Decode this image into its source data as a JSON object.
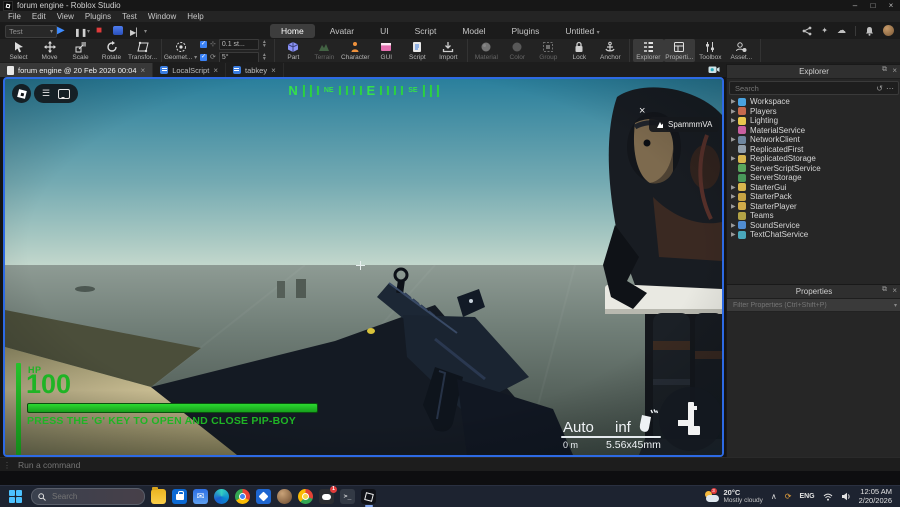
{
  "window": {
    "title": "forum engine - Roblox Studio"
  },
  "menu": {
    "items": [
      "File",
      "Edit",
      "View",
      "Plugins",
      "Test",
      "Window",
      "Help"
    ]
  },
  "playbar": {
    "test_mode": "Test"
  },
  "tabs": {
    "items": [
      "Home",
      "Avatar",
      "UI",
      "Script",
      "Model",
      "Plugins",
      "Untitled"
    ],
    "active": "Home"
  },
  "ribbon": {
    "select": "Select",
    "move": "Move",
    "scale": "Scale",
    "rotate": "Rotate",
    "transform": "Transfor...",
    "geometric": "Geomet...",
    "snap_move": "0.1 st...",
    "snap_rotate": "5°",
    "part": "Part",
    "terrain": "Terrain",
    "character": "Character",
    "gui": "GUI",
    "script": "Script",
    "import": "Import",
    "material": "Material",
    "color": "Color",
    "group": "Group",
    "lock": "Lock",
    "anchor": "Anchor",
    "explorer": "Explorer",
    "properties": "Properti...",
    "toolbox": "Toolbox",
    "asset": "Asset..."
  },
  "doc_tabs": {
    "items": [
      "forum engine @ 20 Feb 2026 00:04",
      "LocalScript",
      "tabkey"
    ]
  },
  "game": {
    "compass": {
      "n": "N",
      "ne": "NE",
      "e": "E",
      "se": "SE"
    },
    "nametag": "SpammmVA",
    "hp_label": "HP",
    "hp_value": "100",
    "pipboy_hint": "PRESS THE 'G' KEY TO OPEN AND CLOSE PIP-BOY",
    "fire_mode": "Auto",
    "ammo_count": "inf",
    "distance": "0 m",
    "caliber": "5.56x45mm"
  },
  "explorer": {
    "title": "Explorer",
    "search_placeholder": "Search",
    "items": [
      {
        "label": "Workspace",
        "expandable": true
      },
      {
        "label": "Players",
        "expandable": true
      },
      {
        "label": "Lighting",
        "expandable": true
      },
      {
        "label": "MaterialService",
        "expandable": false
      },
      {
        "label": "NetworkClient",
        "expandable": true
      },
      {
        "label": "ReplicatedFirst",
        "expandable": false
      },
      {
        "label": "ReplicatedStorage",
        "expandable": true
      },
      {
        "label": "ServerScriptService",
        "expandable": false
      },
      {
        "label": "ServerStorage",
        "expandable": false
      },
      {
        "label": "StarterGui",
        "expandable": true
      },
      {
        "label": "StarterPack",
        "expandable": true
      },
      {
        "label": "StarterPlayer",
        "expandable": true
      },
      {
        "label": "Teams",
        "expandable": false
      },
      {
        "label": "SoundService",
        "expandable": true
      },
      {
        "label": "TextChatService",
        "expandable": true
      }
    ]
  },
  "properties": {
    "title": "Properties",
    "filter_placeholder": "Filter Properties (Ctrl+Shift+P)"
  },
  "command_bar": {
    "placeholder": "Run a command"
  },
  "taskbar": {
    "search_placeholder": "Search",
    "discord_badge": "1",
    "weather_temp": "20°C",
    "weather_condition": "Mostly cloudy",
    "language": "ENG",
    "time": "12:05 AM",
    "date": "2/20/2026"
  },
  "colors": {
    "hud_green": "#1fb425",
    "viewport_border": "#2d6ae4",
    "accent_blue": "#3b82f6"
  }
}
